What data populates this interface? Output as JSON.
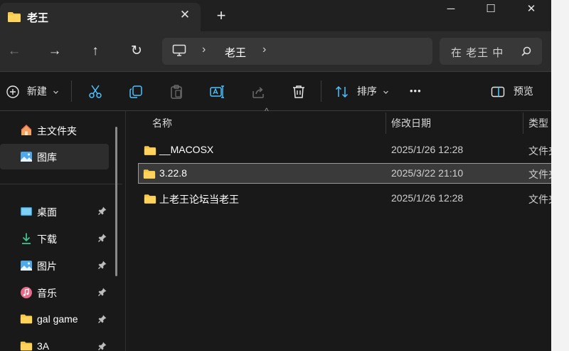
{
  "tab": {
    "title": "老王",
    "close_glyph": "✕",
    "new_tab_glyph": "+"
  },
  "window_controls": {
    "minimize": "─",
    "maximize": "☐",
    "close": "✕"
  },
  "nav": {
    "back": "←",
    "forward": "→",
    "up": "↑",
    "refresh": "↻"
  },
  "address": {
    "separator": "›",
    "crumb": "老王"
  },
  "search": {
    "placeholder": "在 老王 中"
  },
  "commands": {
    "new": "新建",
    "sort": "排序",
    "more": "•••",
    "preview": "预览",
    "icons": [
      "plus-circle-icon",
      "cut-icon",
      "copy-icon",
      "paste-icon",
      "rename-icon",
      "share-icon",
      "delete-icon",
      "sort-icon",
      "more-icon",
      "preview-pane-icon"
    ]
  },
  "sidebar": {
    "items": [
      {
        "label": "主文件夹",
        "icon": "home-icon",
        "selected": false,
        "pinned": false
      },
      {
        "label": "图库",
        "icon": "gallery-icon",
        "selected": true,
        "pinned": false
      },
      {
        "label": "桌面",
        "icon": "desktop-icon",
        "selected": false,
        "pinned": true
      },
      {
        "label": "下载",
        "icon": "download-icon",
        "selected": false,
        "pinned": true
      },
      {
        "label": "图片",
        "icon": "pictures-icon",
        "selected": false,
        "pinned": true
      },
      {
        "label": "音乐",
        "icon": "music-icon",
        "selected": false,
        "pinned": true
      },
      {
        "label": "gal game",
        "icon": "folder-icon",
        "selected": false,
        "pinned": true
      },
      {
        "label": "3A",
        "icon": "folder-icon",
        "selected": false,
        "pinned": true
      }
    ]
  },
  "columns": {
    "name": "名称",
    "modified": "修改日期",
    "type": "类型",
    "sort_glyph": "^"
  },
  "files": [
    {
      "name": "__MACOSX",
      "modified": "2025/1/26 12:28",
      "type": "文件夹",
      "selected": false
    },
    {
      "name": "3.22.8",
      "modified": "2025/3/22 21:10",
      "type": "文件夹",
      "selected": true
    },
    {
      "name": "上老王论坛当老王",
      "modified": "2025/1/26 12:28",
      "type": "文件夹",
      "selected": false
    }
  ],
  "colors": {
    "folder": "#f8c743",
    "accent": "#4cc2ff",
    "background": "#191919"
  }
}
